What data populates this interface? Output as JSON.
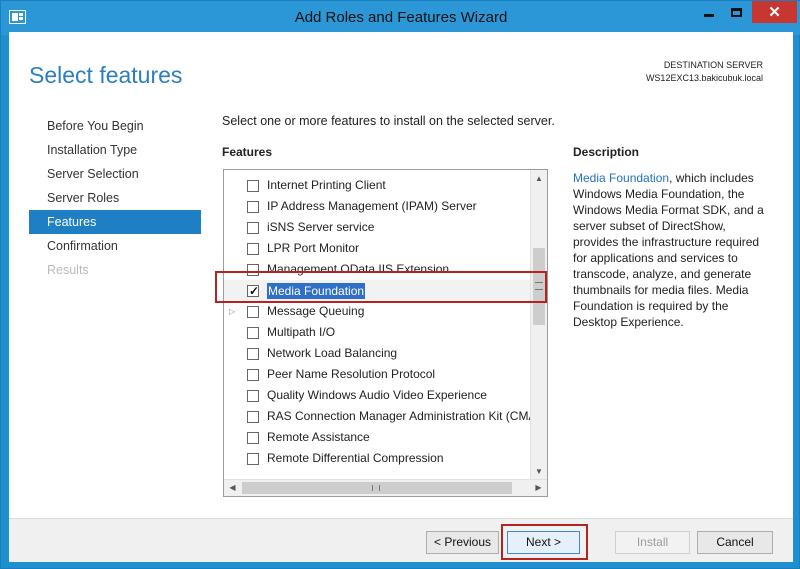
{
  "window": {
    "title": "Add Roles and Features Wizard",
    "controls": {
      "minimize": "–",
      "maximize": "□",
      "close": "✕"
    }
  },
  "header": {
    "page_title": "Select features",
    "destination_label": "DESTINATION SERVER",
    "destination_server": "WS12EXC13.bakicubuk.local"
  },
  "nav": {
    "items": [
      {
        "label": "Before You Begin",
        "state": "normal"
      },
      {
        "label": "Installation Type",
        "state": "normal"
      },
      {
        "label": "Server Selection",
        "state": "normal"
      },
      {
        "label": "Server Roles",
        "state": "normal"
      },
      {
        "label": "Features",
        "state": "active"
      },
      {
        "label": "Confirmation",
        "state": "normal"
      },
      {
        "label": "Results",
        "state": "disabled"
      }
    ]
  },
  "main": {
    "intro": "Select one or more features to install on the selected server.",
    "features_heading": "Features",
    "features": [
      {
        "label": "Internet Printing Client",
        "checked": false
      },
      {
        "label": "IP Address Management (IPAM) Server",
        "checked": false
      },
      {
        "label": "iSNS Server service",
        "checked": false
      },
      {
        "label": "LPR Port Monitor",
        "checked": false
      },
      {
        "label": "Management OData IIS Extension",
        "checked": false
      },
      {
        "label": "Media Foundation",
        "checked": true,
        "selected": true
      },
      {
        "label": "Message Queuing",
        "checked": false,
        "expandable": true
      },
      {
        "label": "Multipath I/O",
        "checked": false
      },
      {
        "label": "Network Load Balancing",
        "checked": false
      },
      {
        "label": "Peer Name Resolution Protocol",
        "checked": false
      },
      {
        "label": "Quality Windows Audio Video Experience",
        "checked": false
      },
      {
        "label": "RAS Connection Manager Administration Kit (CMA",
        "checked": false
      },
      {
        "label": "Remote Assistance",
        "checked": false
      },
      {
        "label": "Remote Differential Compression",
        "checked": false
      }
    ],
    "scroll": {
      "up": "▲",
      "down": "▼",
      "left": "◀",
      "right": "▶"
    }
  },
  "description": {
    "heading": "Description",
    "link_text": "Media Foundation",
    "body": ", which includes Windows Media Foundation, the Windows Media Format SDK, and a server subset of DirectShow, provides the infrastructure required for applications and services to transcode, analyze, and generate thumbnails for media files. Media Foundation is required by the Desktop Experience."
  },
  "footer": {
    "previous": "< Previous",
    "next": "Next >",
    "install": "Install",
    "cancel": "Cancel"
  },
  "colors": {
    "accent": "#1f7fc5",
    "title_bar": "#2b97d6",
    "close": "#c7372f",
    "highlight": "#b72121"
  },
  "icons": {
    "app": "server-manager-icon",
    "check": "checkmark-icon",
    "expander": "expand-arrow-icon"
  }
}
